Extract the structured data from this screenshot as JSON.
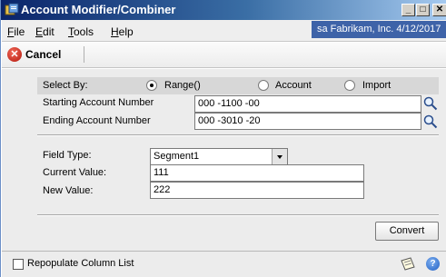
{
  "window": {
    "title": "Account Modifier/Combiner",
    "icon": "app-icon",
    "controls": {
      "minimize": "_",
      "maximize": "□",
      "close": "✕"
    }
  },
  "menu": {
    "items": [
      "File",
      "Edit",
      "Tools",
      "Help"
    ],
    "user_info": "sa  Fabrikam, Inc.  4/12/2017"
  },
  "toolbar": {
    "cancel_label": "Cancel",
    "cancel_icon": "cancel-icon"
  },
  "select_by": {
    "label": "Select By:",
    "options": [
      "Range()",
      "Account",
      "Import"
    ],
    "selected": "Range()"
  },
  "range": {
    "starting_label": "Starting Account Number",
    "starting_value": "000 -1100 -00",
    "ending_label": "Ending Account Number",
    "ending_value": "000 -3010 -20"
  },
  "fields": {
    "field_type_label": "Field Type:",
    "field_type_value": "Segment1",
    "current_value_label": "Current Value:",
    "current_value": "111",
    "new_value_label": "New Value:",
    "new_value": "222"
  },
  "actions": {
    "convert_label": "Convert"
  },
  "statusbar": {
    "repopulate_label": "Repopulate Column List",
    "repopulate_checked": false,
    "note_icon": "note-icon",
    "help_icon": "help-icon",
    "help_glyph": "?"
  },
  "colors": {
    "title_bar": "#0a246a",
    "user_info_bg": "#3e63a8",
    "cancel_red": "#c0392b"
  }
}
